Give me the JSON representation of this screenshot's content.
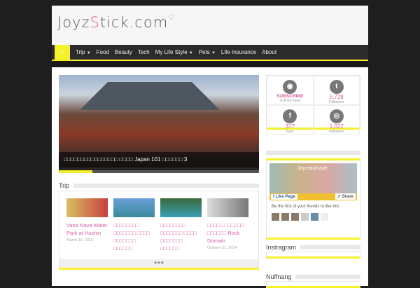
{
  "site": {
    "logo": "JoyzStick.com",
    "logo_a": "Joyz",
    "logo_b": "S",
    "logo_c": "tick.com"
  },
  "nav": {
    "items": [
      {
        "label": "Trip"
      },
      {
        "label": "Food"
      },
      {
        "label": "Beauty"
      },
      {
        "label": "Tech"
      },
      {
        "label": "My Life Style"
      },
      {
        "label": "Pets"
      },
      {
        "label": "Life Insurance"
      },
      {
        "label": "About"
      }
    ]
  },
  "slider": {
    "caption": "□□□□□□□□□□□□□□□□ □□□□ Japan 101 □□□□□□ 3"
  },
  "trip": {
    "title": "Trip",
    "posts": [
      {
        "title": "Vana Nava Water Park at Hushin",
        "date": "March 18, 2015"
      },
      {
        "title": "□□□□□□□□ □□□□□□□ □□□□ □□□□□□□ □□□□□□ □□□□□□□",
        "date": ""
      },
      {
        "title": "□□□□□□□□ □□□□□□□ □□□□ □□□□□□□ □□□□□□ □□□□□□□",
        "date": ""
      },
      {
        "title": "□□□□□ □□□□□□ □□□□□□ Rock Domain",
        "date": "October 21, 2014"
      }
    ],
    "dots": "●●●"
  },
  "social": [
    {
      "icon": "rss-icon",
      "value": "SUBSCRIBE",
      "label": "To RSS Feed"
    },
    {
      "icon": "twitter-icon",
      "value": "5,728",
      "label": "Followers"
    },
    {
      "icon": "facebook-icon",
      "value": "377",
      "label": "Fans"
    },
    {
      "icon": "instagram-icon",
      "value": "1,022",
      "label": "Followers"
    }
  ],
  "facebook": {
    "page_name": "Joyzstickstyle",
    "like": "Like Page",
    "share": "Share",
    "text": "Be the first of your friends to like this"
  },
  "widgets": {
    "instagram": "Instragram",
    "nuffnang": "Nuffnang"
  },
  "colors": {
    "accent": "#f5f02a",
    "pink": "#d45fa0"
  }
}
